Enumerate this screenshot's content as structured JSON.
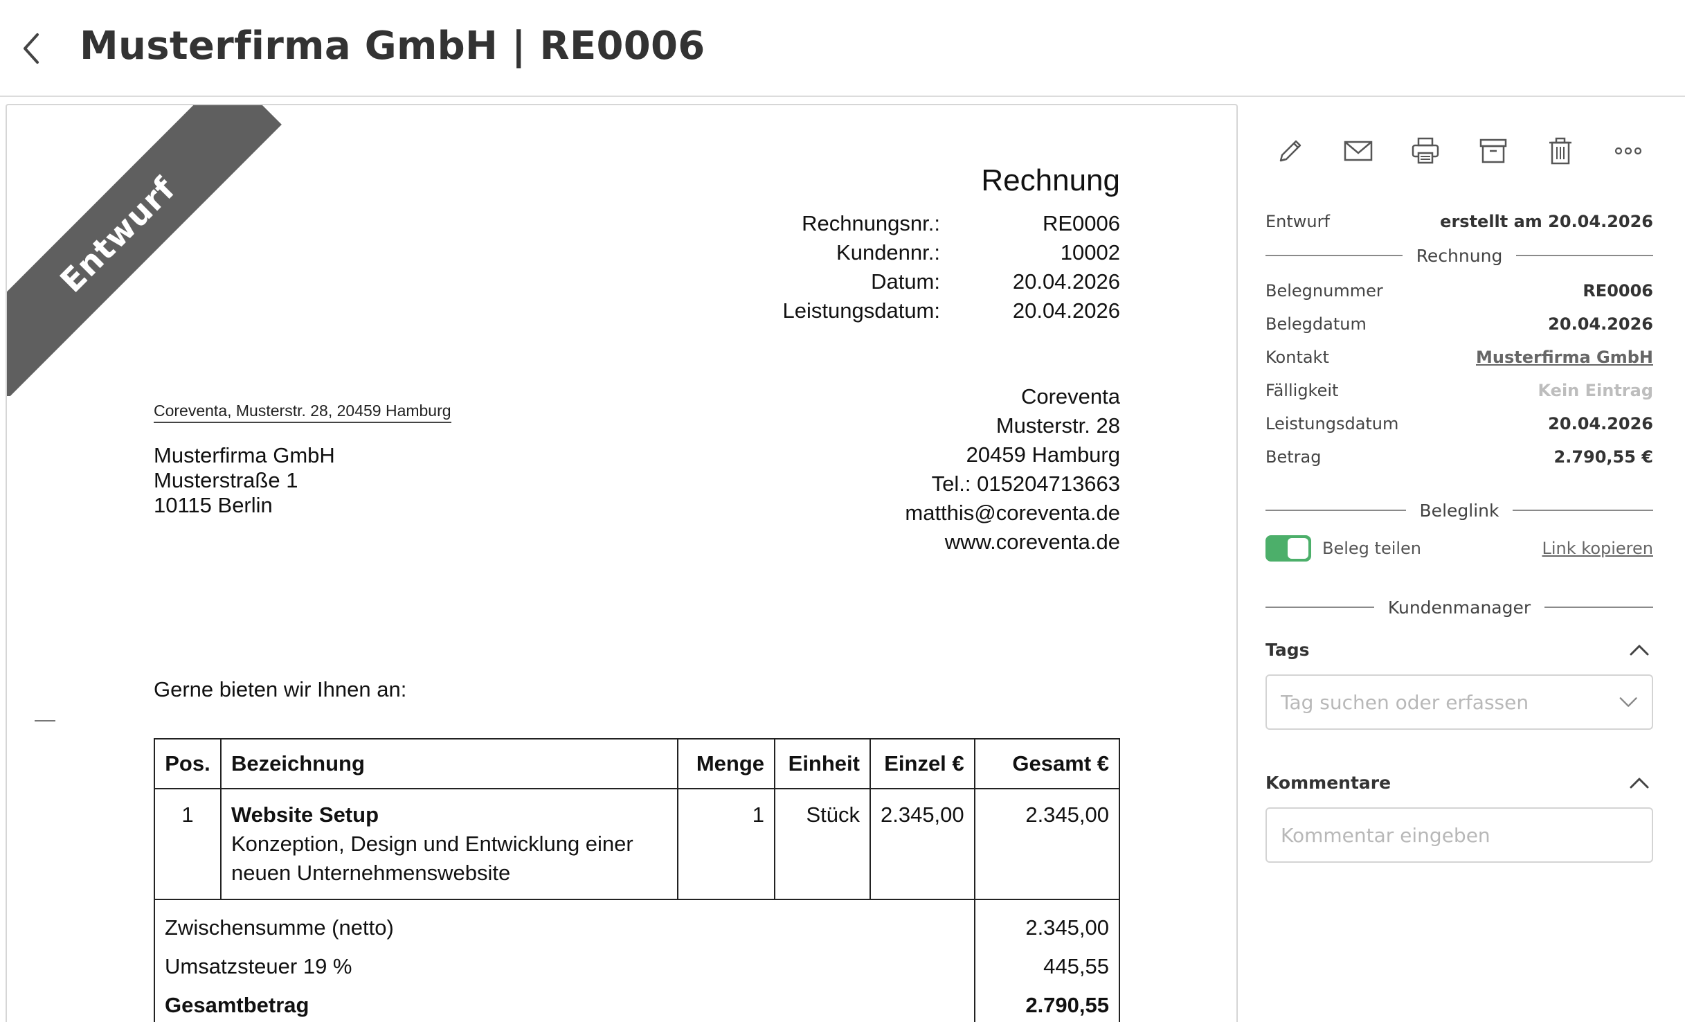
{
  "header": {
    "title": "Musterfirma GmbH | RE0006"
  },
  "document": {
    "ribbon": "Entwurf",
    "type": "Rechnung",
    "meta": [
      {
        "label": "Rechnungsnr.:",
        "value": "RE0006"
      },
      {
        "label": "Kundennr.:",
        "value": "10002"
      },
      {
        "label": "Datum:",
        "value": "20.04.2026"
      },
      {
        "label": "Leistungsdatum:",
        "value": "20.04.2026"
      }
    ],
    "sender_line": "Coreventa, Musterstr. 28, 20459 Hamburg",
    "recipient": [
      "Musterfirma GmbH",
      "Musterstraße 1",
      "10115 Berlin"
    ],
    "company": [
      "Coreventa",
      "Musterstr. 28",
      "20459 Hamburg",
      "Tel.: 015204713663",
      "matthis@coreventa.de",
      "www.coreventa.de"
    ],
    "intro": "Gerne bieten wir Ihnen an:",
    "table": {
      "headers": [
        "Pos.",
        "Bezeichnung",
        "Menge",
        "Einheit",
        "Einzel €",
        "Gesamt €"
      ],
      "rows": [
        {
          "pos": "1",
          "title": "Website Setup",
          "desc_1": "Konzeption, Design und Entwicklung einer",
          "desc_2": "neuen Unternehmenswebsite",
          "menge": "1",
          "einheit": "Stück",
          "einzel": "2.345,00",
          "gesamt": "2.345,00"
        }
      ],
      "subtotal_label": "Zwischensumme (netto)",
      "subtotal_value": "2.345,00",
      "tax_label": "Umsatzsteuer 19 %",
      "tax_value": "445,55",
      "total_label": "Gesamtbetrag",
      "total_value": "2.790,55"
    }
  },
  "sidebar": {
    "status": "Entwurf",
    "created": "erstellt am 20.04.2026",
    "section_rechnung": "Rechnung",
    "fields": [
      {
        "label": "Belegnummer",
        "value": "RE0006"
      },
      {
        "label": "Belegdatum",
        "value": "20.04.2026"
      },
      {
        "label": "Kontakt",
        "value": "Musterfirma GmbH"
      },
      {
        "label": "Fälligkeit",
        "value": "Kein Eintrag"
      },
      {
        "label": "Leistungsdatum",
        "value": "20.04.2026"
      },
      {
        "label": "Betrag",
        "value": "2.790,55 €"
      }
    ],
    "section_beleglink": "Beleglink",
    "share_label": "Beleg teilen",
    "share_enabled": true,
    "copy_link": "Link kopieren",
    "section_kunden": "Kundenmanager",
    "tags_title": "Tags",
    "tags_placeholder": "Tag suchen oder erfassen",
    "comments_title": "Kommentare",
    "comments_placeholder": "Kommentar eingeben"
  },
  "colors": {
    "toggle_on": "#4caf6a",
    "ribbon": "#5f5f5f",
    "muted": "#bdbdbd"
  },
  "icons": [
    "back-arrow-icon",
    "pencil-icon",
    "mail-icon",
    "printer-icon",
    "archive-icon",
    "trash-icon",
    "more-icon",
    "chevron-up-icon",
    "chevron-down-icon"
  ]
}
